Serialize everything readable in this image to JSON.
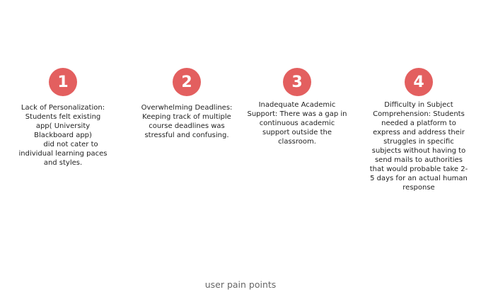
{
  "theme": {
    "badge_color": "#e35f5f"
  },
  "points": [
    {
      "number": "1",
      "lines": [
        "Lack of Personalization:",
        "Students felt existing",
        "app( University",
        "Blackboard app)",
        "did not cater to",
        "individual learning paces",
        "and styles."
      ]
    },
    {
      "number": "2",
      "lines": [
        "Overwhelming Deadlines:",
        "Keeping track of multiple",
        "course deadlines was",
        "stressful and confusing."
      ]
    },
    {
      "number": "3",
      "lines": [
        "Inadequate Academic",
        "Support: There was a gap in",
        "continuous academic",
        "support outside the",
        "classroom."
      ]
    },
    {
      "number": "4",
      "lines": [
        "Difficulty in Subject",
        "Comprehension: Students",
        "needed a platform to",
        "express and address their",
        "struggles in specific",
        "subjects without having to",
        "send mails to authorities",
        "that would probable take 2-",
        "5 days for an actual human",
        "response"
      ]
    }
  ],
  "footer": {
    "caption": "user pain points"
  }
}
